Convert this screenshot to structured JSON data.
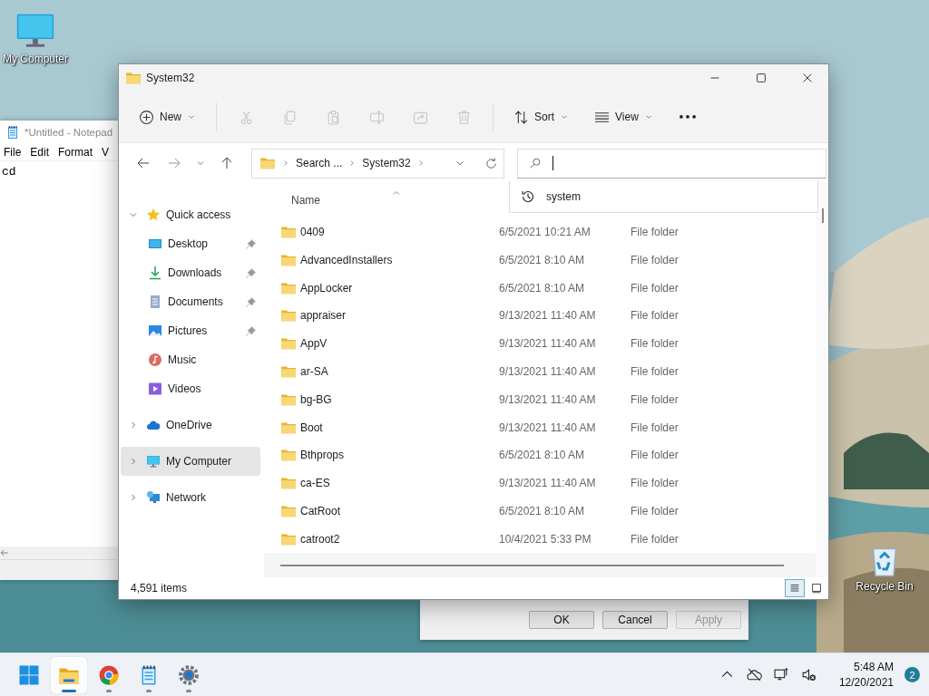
{
  "desktop_icons": [
    {
      "kind": "computer",
      "label": "My Computer"
    },
    {
      "kind": "recycle",
      "label": "Recycle Bin"
    }
  ],
  "notepad": {
    "title": "*Untitled - Notepad",
    "menu": [
      "File",
      "Edit",
      "Format",
      "V"
    ],
    "text": "cd"
  },
  "dialog": {
    "buttons": [
      {
        "label": "OK",
        "disabled": false
      },
      {
        "label": "Cancel",
        "disabled": false
      },
      {
        "label": "Apply",
        "disabled": true
      }
    ]
  },
  "explorer": {
    "title": "System32",
    "commands": [
      {
        "kind": "new",
        "label": "New",
        "disabled": false
      },
      {
        "kind": "cut",
        "disabled": true
      },
      {
        "kind": "copy",
        "disabled": true
      },
      {
        "kind": "paste",
        "disabled": true
      },
      {
        "kind": "rename",
        "disabled": true
      },
      {
        "kind": "share",
        "disabled": true
      },
      {
        "kind": "delete",
        "disabled": true
      },
      {
        "kind": "sort",
        "label": "Sort",
        "disabled": false
      },
      {
        "kind": "view",
        "label": "View",
        "disabled": false
      },
      {
        "kind": "more",
        "disabled": false
      }
    ],
    "address": {
      "crumbs": [
        "Search ...",
        "System32"
      ]
    },
    "search": {
      "suggestions": [
        "system"
      ]
    },
    "sidebar": {
      "items": [
        {
          "kind": "star",
          "label": "Quick access",
          "expanded": true,
          "selected": false,
          "children": [
            {
              "kind": "desktop",
              "label": "Desktop",
              "pinned": true,
              "selected": false
            },
            {
              "kind": "downloads",
              "label": "Downloads",
              "pinned": true,
              "selected": false
            },
            {
              "kind": "documents",
              "label": "Documents",
              "pinned": true,
              "selected": false
            },
            {
              "kind": "pictures",
              "label": "Pictures",
              "pinned": true,
              "selected": false
            },
            {
              "kind": "music",
              "label": "Music",
              "pinned": false,
              "selected": false
            },
            {
              "kind": "videos",
              "label": "Videos",
              "pinned": false,
              "selected": false
            }
          ]
        },
        {
          "kind": "cloud",
          "label": "OneDrive",
          "expanded": false,
          "selected": false
        },
        {
          "kind": "computer",
          "label": "My Computer",
          "expanded": false,
          "selected": true
        },
        {
          "kind": "network",
          "label": "Network",
          "expanded": false,
          "selected": false
        }
      ]
    },
    "table": {
      "columns": [
        {
          "label": "Name",
          "sorted": true
        }
      ],
      "rows": [
        {
          "name": "0409",
          "date": "6/5/2021 10:21 AM",
          "type": "File folder"
        },
        {
          "name": "AdvancedInstallers",
          "date": "6/5/2021 8:10 AM",
          "type": "File folder"
        },
        {
          "name": "AppLocker",
          "date": "6/5/2021 8:10 AM",
          "type": "File folder"
        },
        {
          "name": "appraiser",
          "date": "9/13/2021 11:40 AM",
          "type": "File folder"
        },
        {
          "name": "AppV",
          "date": "9/13/2021 11:40 AM",
          "type": "File folder"
        },
        {
          "name": "ar-SA",
          "date": "9/13/2021 11:40 AM",
          "type": "File folder"
        },
        {
          "name": "bg-BG",
          "date": "9/13/2021 11:40 AM",
          "type": "File folder"
        },
        {
          "name": "Boot",
          "date": "9/13/2021 11:40 AM",
          "type": "File folder"
        },
        {
          "name": "Bthprops",
          "date": "6/5/2021 8:10 AM",
          "type": "File folder"
        },
        {
          "name": "ca-ES",
          "date": "9/13/2021 11:40 AM",
          "type": "File folder"
        },
        {
          "name": "CatRoot",
          "date": "6/5/2021 8:10 AM",
          "type": "File folder"
        },
        {
          "name": "catroot2",
          "date": "10/4/2021 5:33 PM",
          "type": "File folder"
        }
      ]
    },
    "status_bar": {
      "count": "4,591 items",
      "views": [
        {
          "kind": "details",
          "selected": true
        },
        {
          "kind": "tiles",
          "selected": false
        }
      ]
    }
  },
  "taskbar": {
    "apps": [
      {
        "kind": "start",
        "running": false,
        "active": false
      },
      {
        "kind": "explorer",
        "running": true,
        "active": true
      },
      {
        "kind": "browser",
        "running": true,
        "active": false
      },
      {
        "kind": "notepad",
        "running": true,
        "active": false
      },
      {
        "kind": "settings",
        "running": true,
        "active": false
      }
    ],
    "tray": [
      {
        "kind": "chevron"
      },
      {
        "kind": "cloud-off"
      },
      {
        "kind": "network"
      },
      {
        "kind": "speaker-muted"
      }
    ],
    "time": "5:48 AM",
    "date": "12/20/2021",
    "notifications": "2"
  }
}
